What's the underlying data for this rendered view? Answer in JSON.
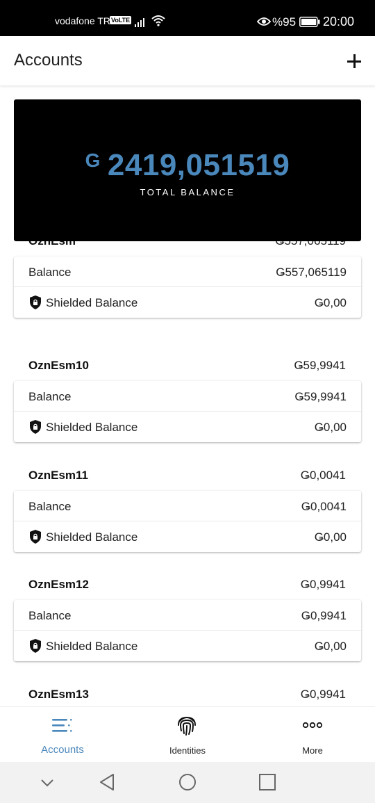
{
  "status_bar": {
    "carrier": "vodafone TR",
    "volte": "VoLTE",
    "battery_percent": "%95",
    "time": "20:00",
    "icons": [
      "signal-icon",
      "wifi-icon",
      "eye-icon",
      "battery-icon"
    ]
  },
  "header": {
    "title": "Accounts",
    "add_icon": "plus-icon"
  },
  "total": {
    "currency_symbol": "G",
    "amount": "2419,051519",
    "label": "TOTAL BALANCE"
  },
  "colors": {
    "accent": "#4a88bc",
    "card_bg": "#000000"
  },
  "accounts": [
    {
      "name": "OznEsm",
      "total": "Ǥ557,065119",
      "balance_label": "Balance",
      "balance": "Ǥ557,065119",
      "shielded_label": "Shielded Balance",
      "shielded": "Ǥ0,00"
    },
    {
      "name": "OznEsm10",
      "total": "Ǥ59,9941",
      "balance_label": "Balance",
      "balance": "Ǥ59,9941",
      "shielded_label": "Shielded Balance",
      "shielded": "Ǥ0,00"
    },
    {
      "name": "OznEsm11",
      "total": "Ǥ0,0041",
      "balance_label": "Balance",
      "balance": "Ǥ0,0041",
      "shielded_label": "Shielded Balance",
      "shielded": "Ǥ0,00"
    },
    {
      "name": "OznEsm12",
      "total": "Ǥ0,9941",
      "balance_label": "Balance",
      "balance": "Ǥ0,9941",
      "shielded_label": "Shielded Balance",
      "shielded": "Ǥ0,00"
    },
    {
      "name": "OznEsm13",
      "total": "Ǥ0,9941"
    }
  ],
  "bottom_nav": {
    "items": [
      {
        "label": "Accounts",
        "icon": "list-icon",
        "active": true
      },
      {
        "label": "Identities",
        "icon": "fingerprint-icon",
        "active": false
      },
      {
        "label": "More",
        "icon": "more-dots-icon",
        "active": false
      }
    ]
  },
  "system_nav": {
    "icons": [
      "chevron-down-icon",
      "back-triangle-icon",
      "home-circle-icon",
      "recents-square-icon"
    ]
  }
}
